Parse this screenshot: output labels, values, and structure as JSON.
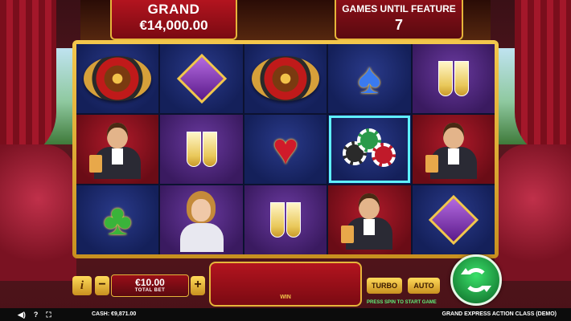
{
  "jackpot": {
    "label": "GRAND",
    "amount": "€14,000.00"
  },
  "feature": {
    "label": "GAMES UNTIL FEATURE",
    "count": "7"
  },
  "reels": [
    [
      "roulette-wheel-symbol",
      "purple-diamond-symbol",
      "roulette-wheel-symbol",
      "blue-spade-symbol",
      "champagne-glasses-symbol"
    ],
    [
      "gentleman-symbol",
      "champagne-glasses-symbol",
      "red-heart-symbol",
      "casino-chips-symbol",
      "gentleman-symbol"
    ],
    [
      "green-club-symbol",
      "lady-symbol",
      "champagne-glasses-symbol",
      "gentleman-symbol",
      "purple-diamond-symbol"
    ]
  ],
  "controls": {
    "info_label": "i",
    "minus_label": "−",
    "plus_label": "+",
    "bet_amount": "€10.00",
    "bet_label": "TOTAL BET",
    "win_label": "WIN",
    "turbo_label": "TURBO",
    "auto_label": "AUTO",
    "spin_hint": "PRESS SPIN TO START GAME"
  },
  "footer": {
    "sound_icon": "◀)",
    "help_icon": "?",
    "fullscreen_icon": "⛶",
    "cash_label": "CASH:",
    "cash_value": "€9,871.00",
    "game_title": "GRAND EXPRESS ACTION CLASS (DEMO)"
  },
  "colors": {
    "gold": "#e6b53a",
    "red_panel": "#b3141f",
    "spin_green": "#3ae06a",
    "highlight": "#5ff0ff"
  }
}
